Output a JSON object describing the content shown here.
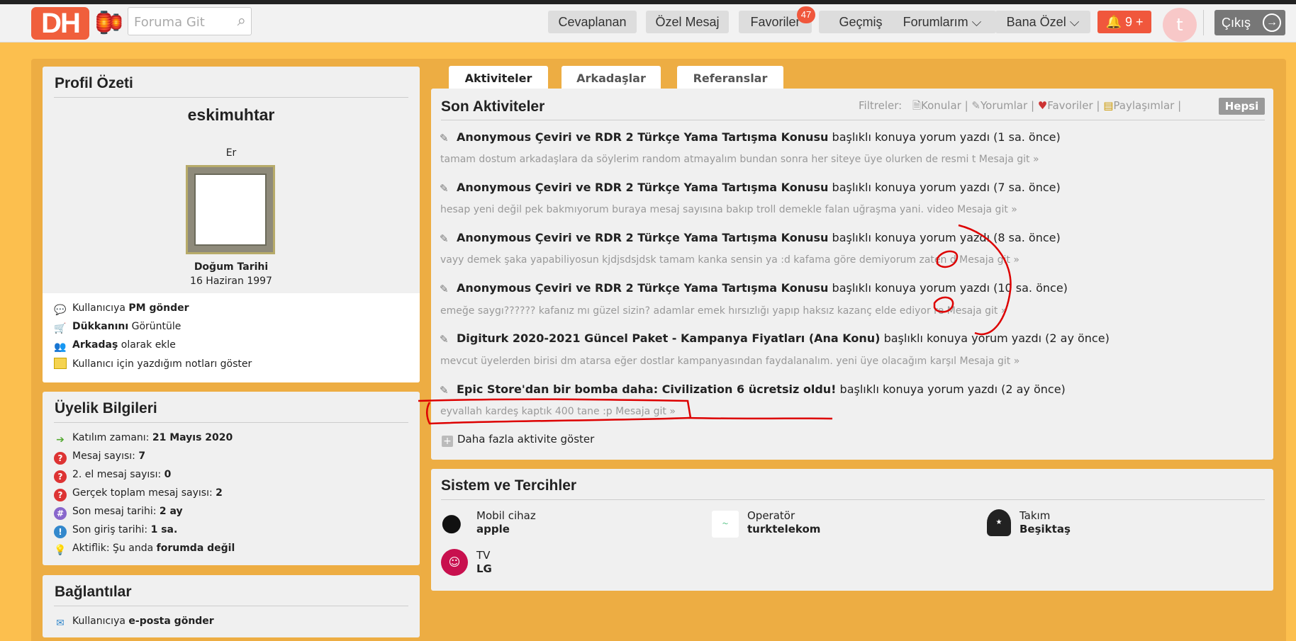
{
  "header": {
    "logo_text": "DH",
    "search_placeholder": "Foruma Git",
    "nav": [
      "Cevaplanan",
      "Özel Mesaj",
      "Favoriler",
      "Geçmiş",
      "Forumlarım ⌵",
      "Bana Özel ⌵"
    ],
    "favorites_badge": "47",
    "notifications": "🔔 9 +",
    "avatar_letter": "t",
    "logout_label": "Çıkış"
  },
  "profile": {
    "title": "Profil Özeti",
    "username": "eskimuhtar",
    "gender": "Er",
    "birth_label": "Doğum Tarihi",
    "birth_date": "16 Haziran 1997",
    "actions": [
      {
        "pre": "Kullanıcıya ",
        "bold": "PM gönder",
        "post": ""
      },
      {
        "pre": "",
        "bold": "Dükkanını",
        "post": " Görüntüle"
      },
      {
        "pre": "",
        "bold": "Arkadaş",
        "post": " olarak ekle"
      },
      {
        "pre": "Kullanıcı için yazdığım notları göster",
        "bold": "",
        "post": ""
      }
    ]
  },
  "membership": {
    "title": "Üyelik Bilgileri",
    "rows": [
      {
        "label": "Katılım zamanı: ",
        "value": "21 Mayıs 2020"
      },
      {
        "label": "Mesaj sayısı: ",
        "value": "7"
      },
      {
        "label": "2. el mesaj sayısı: ",
        "value": "0"
      },
      {
        "label": "Gerçek toplam mesaj sayısı: ",
        "value": "2"
      },
      {
        "label": "Son mesaj tarihi: ",
        "value": "2 ay"
      },
      {
        "label": "Son giriş tarihi: ",
        "value": "1 sa."
      },
      {
        "label": "Aktiflik: Şu anda ",
        "value": "forumda değil"
      }
    ]
  },
  "links": {
    "title": "Bağlantılar",
    "rows": [
      {
        "pre": "Kullanıcıya ",
        "bold": "e-posta gönder"
      }
    ]
  },
  "tabs": [
    "Aktiviteler",
    "Arkadaşlar",
    "Referanslar"
  ],
  "activities": {
    "title": "Son Aktiviteler",
    "filters_label": "Filtreler:",
    "filters": [
      "Konular",
      "Yorumlar",
      "Favoriler",
      "Paylaşımlar"
    ],
    "filter_all": "Hepsi",
    "items": [
      {
        "topic": "Anonymous Çeviri ve RDR 2 Türkçe Yama Tartışma Konusu",
        "suffix": " başlıklı konuya yorum yazdı (1 sa. önce)",
        "snippet": "tamam dostum arkadaşlara da söylerim random atmayalım bundan sonra her siteye üye olurken de resmi t Mesaja git »"
      },
      {
        "topic": "Anonymous Çeviri ve RDR 2 Türkçe Yama Tartışma Konusu",
        "suffix": " başlıklı konuya yorum yazdı (7 sa. önce)",
        "snippet": "hesap yeni değil pek bakmıyorum buraya mesaj sayısına bakıp troll demekle falan uğraşma yani. video Mesaja git »"
      },
      {
        "topic": "Anonymous Çeviri ve RDR 2 Türkçe Yama Tartışma Konusu",
        "suffix": " başlıklı konuya yorum yazdı (8 sa. önce)",
        "snippet": "vayy demek şaka yapabiliyosun kjdjsdsjdsk tamam kanka sensin ya :d kafama göre demiyorum zaten d Mesaja git »"
      },
      {
        "topic": "Anonymous Çeviri ve RDR 2 Türkçe Yama Tartışma Konusu",
        "suffix": " başlıklı konuya yorum yazdı (10 sa. önce)",
        "snippet": "emeğe saygı?????? kafanız mı güzel sizin? adamlar emek hırsızlığı yapıp haksız kazanç elde ediyor re Mesaja git »"
      },
      {
        "topic": "Digiturk 2020-2021 Güncel Paket - Kampanya Fiyatları (Ana Konu)",
        "suffix": " başlıklı konuya yorum yazdı (2 ay önce)",
        "snippet": "mevcut üyelerden birisi dm atarsa eğer dostlar kampanyasından faydalanalım. yeni üye olacağım karşıl Mesaja git »"
      },
      {
        "topic": "Epic Store'dan bir bomba daha: Civilization 6 ücretsiz oldu!",
        "suffix": " başlıklı konuya yorum yazdı (2 ay önce)",
        "snippet": "eyvallah kardeş kaptık 400 tane :p Mesaja git »"
      }
    ],
    "more": "Daha fazla aktivite göster"
  },
  "system": {
    "title": "Sistem ve Tercihler",
    "items": [
      {
        "label": "Mobil cihaz",
        "value": "apple",
        "icon": "apple-icon"
      },
      {
        "label": "Operatör",
        "value": "turktelekom",
        "icon": "turktelekom-logo"
      },
      {
        "label": "Takım",
        "value": "Beşiktaş",
        "icon": "besiktas-logo"
      },
      {
        "label": "TV",
        "value": "LG",
        "icon": "lg-logo"
      }
    ]
  },
  "colors": {
    "accent": "#f05f3c",
    "page_bg": "#fcbf4e",
    "content_bg": "#edad43",
    "annotation": "#dd0000"
  }
}
